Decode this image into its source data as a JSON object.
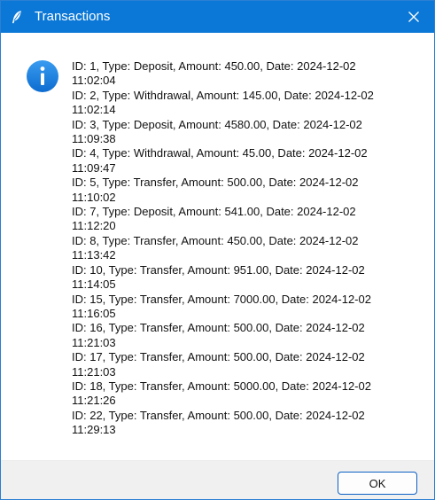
{
  "window": {
    "title": "Transactions",
    "title_icon": "feather-icon",
    "close_icon": "close-icon",
    "accent_color": "#0b78d7"
  },
  "message": {
    "icon": "info-icon",
    "icon_color": "#1a7fd9",
    "lines": [
      "ID: 1, Type: Deposit, Amount: 450.00, Date: 2024-12-02",
      "11:02:04",
      "ID: 2, Type: Withdrawal, Amount: 145.00, Date: 2024-12-02",
      "11:02:14",
      "ID: 3, Type: Deposit, Amount: 4580.00, Date: 2024-12-02",
      "11:09:38",
      "ID: 4, Type: Withdrawal, Amount: 45.00, Date: 2024-12-02",
      "11:09:47",
      "ID: 5, Type: Transfer, Amount: 500.00, Date: 2024-12-02",
      "11:10:02",
      "ID: 7, Type: Deposit, Amount: 541.00, Date: 2024-12-02",
      "11:12:20",
      "ID: 8, Type: Transfer, Amount: 450.00, Date: 2024-12-02",
      "11:13:42",
      "ID: 10, Type: Transfer, Amount: 951.00, Date: 2024-12-02",
      "11:14:05",
      "ID: 15, Type: Transfer, Amount: 7000.00, Date: 2024-12-02",
      "11:16:05",
      "ID: 16, Type: Transfer, Amount: 500.00, Date: 2024-12-02",
      "11:21:03",
      "ID: 17, Type: Transfer, Amount: 500.00, Date: 2024-12-02",
      "11:21:03",
      "ID: 18, Type: Transfer, Amount: 5000.00, Date: 2024-12-02",
      "11:21:26",
      "ID: 22, Type: Transfer, Amount: 500.00, Date: 2024-12-02",
      "11:29:13"
    ]
  },
  "footer": {
    "ok_label": "OK"
  }
}
